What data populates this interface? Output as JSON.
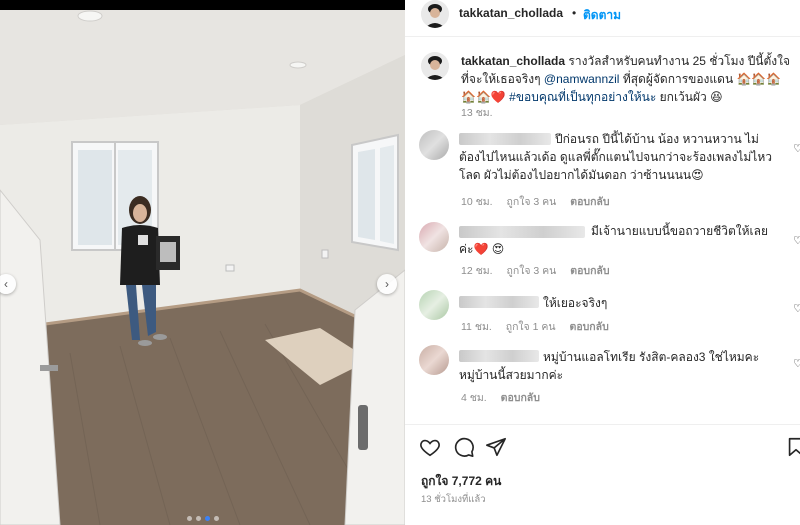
{
  "post": {
    "username": "takkatan_chollada",
    "follow_label": "ติดตาม",
    "separator": "•",
    "caption_mention": "@namwannzil",
    "caption_part1": "รางวัลสำหรับคนทำงาน 25 ชั่วโมง ปีนี้ตั้งใจที่จะให้เธอจริงๆ",
    "caption_part2": "ที่สุดผู้จัดการของแดน 🏠🏠🏠🏠🏠❤️",
    "caption_hashtag": "#ขอบคุณที่เป็นทุกอย่างให้นะ",
    "caption_part3": "ยกเว้นผัว 😆",
    "caption_time": "13 ชม.",
    "likes_text": "ถูกใจ 7,772 คน",
    "posted_ago": "13 ชั่วโมงที่แล้ว"
  },
  "comments": [
    {
      "text": "ปีก่อนรถ ปีนี้ได้บ้าน น้อง หวานหวาน ไม่ต้องไปไหนแล้วเด้อ ดูแลพี่ตั๊กแตนไปจนกว่าจะร้องเพลงไม่ไหวโลด ผัวไม่ต้องไปอยากได้มันดอก ว่าซ้านนนน😍",
      "time": "10 ชม.",
      "likes": "ถูกใจ 3 คน",
      "reply": "ตอบกลับ"
    },
    {
      "text": "มีเจ้านายแบบนี้ขอถวายชีวิตให้เลยค่ะ❤️ 😍",
      "time": "12 ชม.",
      "likes": "ถูกใจ 3 คน",
      "reply": "ตอบกลับ"
    },
    {
      "text": "ให้เยอะจริงๆ",
      "time": "11 ชม.",
      "likes": "ถูกใจ 1 คน",
      "reply": "ตอบกลับ"
    },
    {
      "text": "หมู่บ้านแอลโทเรีย รังสิต-คลอง3 ใช่ไหมคะ หมู่บ้านนี้สวยมากค่ะ",
      "time": "4 ชม.",
      "reply": "ตอบกลับ"
    }
  ],
  "icons": {
    "like": "heart-icon",
    "comment": "comment-icon",
    "share": "share-icon",
    "save": "bookmark-icon",
    "prev": "chevron-left-icon",
    "next": "chevron-right-icon"
  },
  "colors": {
    "link": "#0095f6",
    "mention": "#00376b",
    "muted": "#8e8e8e",
    "carousel_active": "#3b82f6"
  },
  "carousel": {
    "total": 4,
    "active": 3
  }
}
